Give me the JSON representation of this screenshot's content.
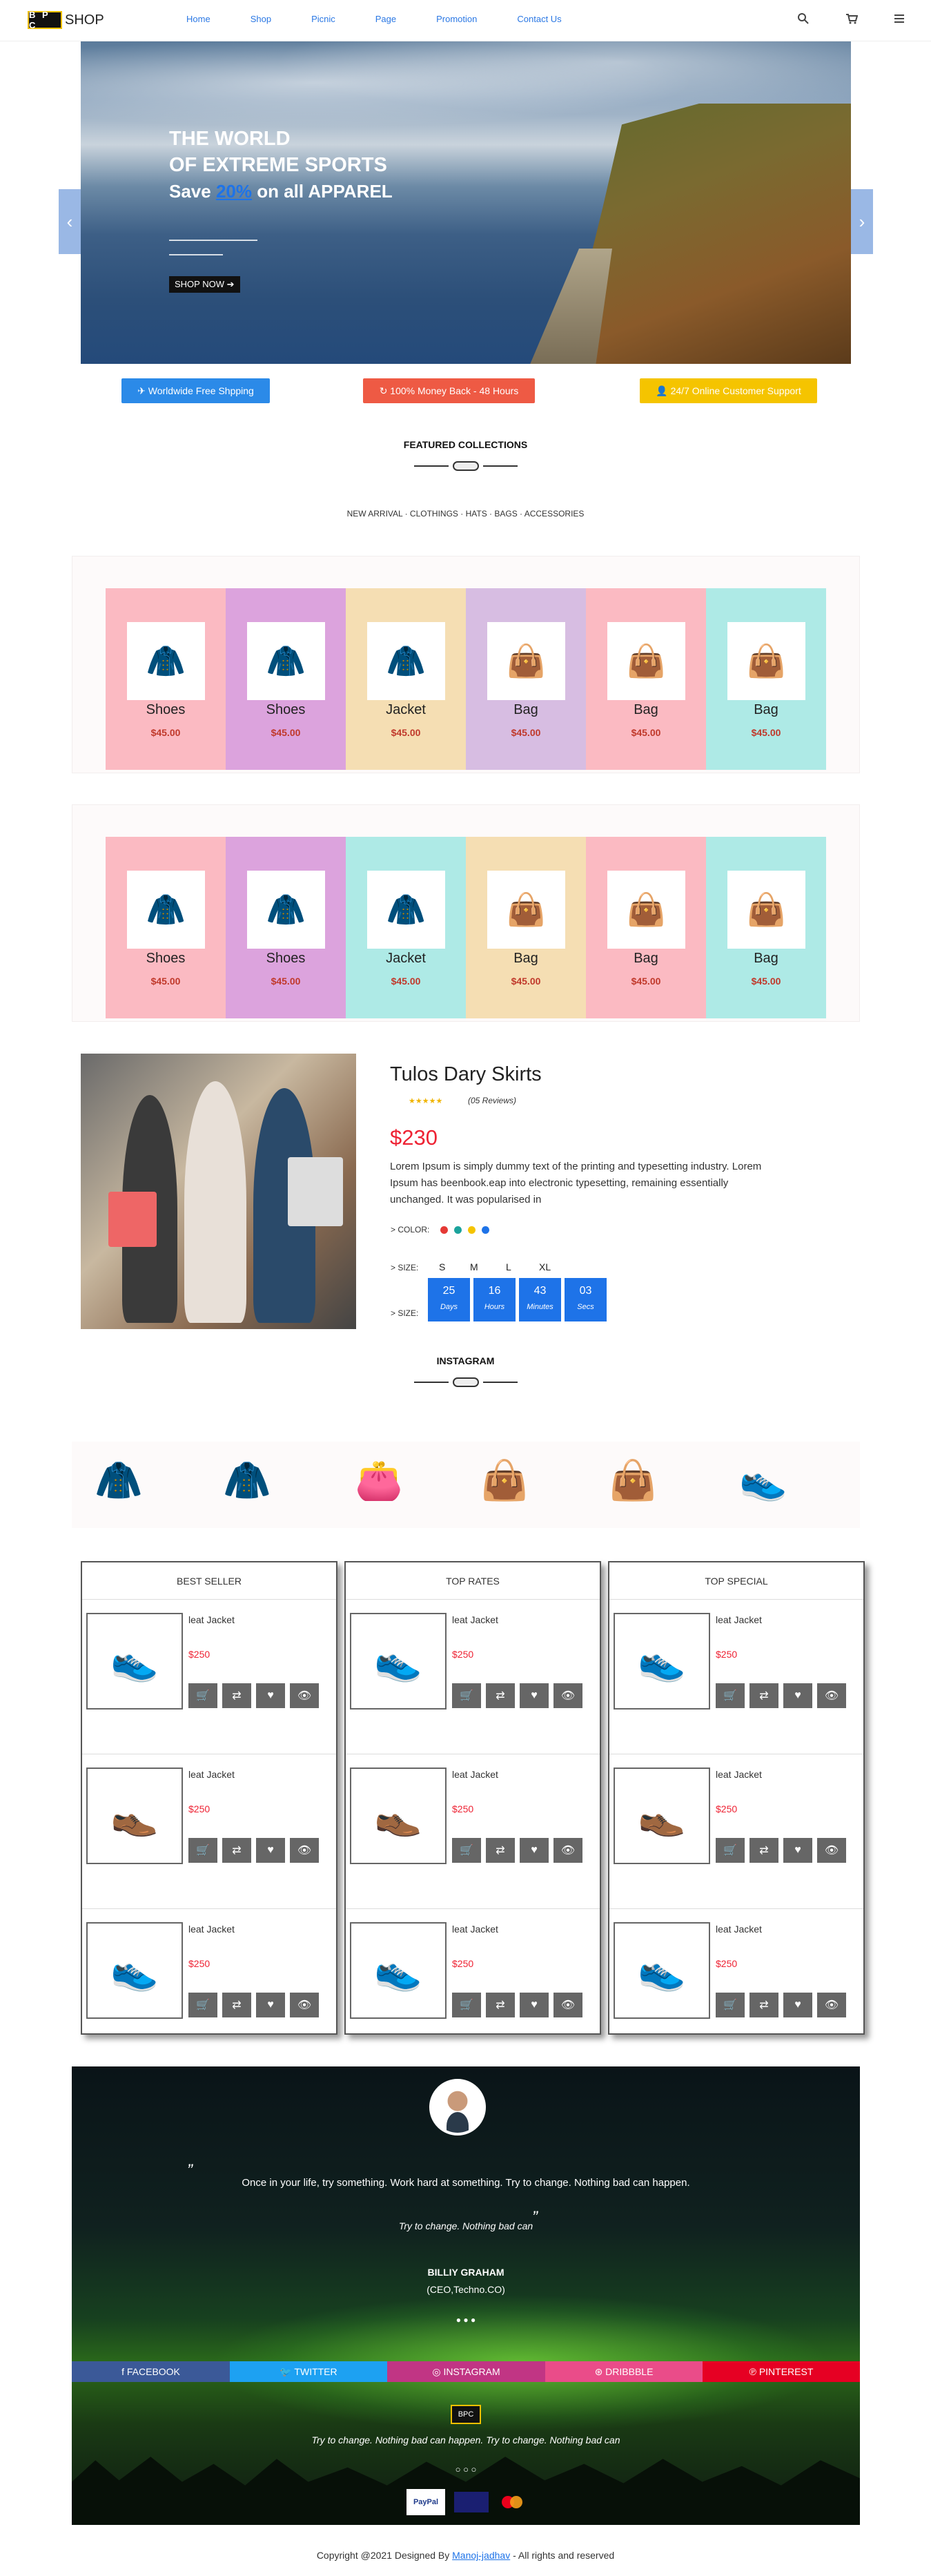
{
  "nav": {
    "logo_mark": "B P C",
    "logo_text": "SHOP",
    "links": [
      "Home",
      "Shop",
      "Picnic",
      "Page",
      "Promotion",
      "Contact Us"
    ]
  },
  "hero": {
    "line1": "THE WORLD",
    "line2": "OF EXTREME SPORTS",
    "save_pre": "Save ",
    "save_pct": "20%",
    "save_post": " on all APPAREL",
    "cta": "SHOP NOW ➔"
  },
  "features": [
    "✈ Worldwide Free Shpping",
    "↻ 100% Money Back - 48 Hours",
    "👤 24/7 Online Customer Support"
  ],
  "featured": {
    "title": "FEATURED COLLECTIONS",
    "filters": "NEW ARRIVAL  ·  CLOTHINGS  ·  HATS  ·  BAGS  ·  ACCESSORIES"
  },
  "row1": [
    {
      "name": "Shoes",
      "price": "$45.00"
    },
    {
      "name": "Shoes",
      "price": "$45.00"
    },
    {
      "name": "Jacket",
      "price": "$45.00"
    },
    {
      "name": "Bag",
      "price": "$45.00"
    },
    {
      "name": "Bag",
      "price": "$45.00"
    },
    {
      "name": "Bag",
      "price": "$45.00"
    }
  ],
  "row2": [
    {
      "name": "Shoes",
      "price": "$45.00"
    },
    {
      "name": "Shoes",
      "price": "$45.00"
    },
    {
      "name": "Jacket",
      "price": "$45.00"
    },
    {
      "name": "Bag",
      "price": "$45.00"
    },
    {
      "name": "Bag",
      "price": "$45.00"
    },
    {
      "name": "Bag",
      "price": "$45.00"
    }
  ],
  "product": {
    "title": "Tulos Dary Skirts",
    "stars": "★★★★★",
    "reviews": "(05 Reviews)",
    "price": "$230",
    "desc": "Lorem Ipsum is simply dummy text of the printing and typesetting industry. Lorem Ipsum has beenbook.eap into electronic typesetting, remaining essentially unchanged. It was popularised in",
    "color_label": "> COLOR:",
    "size_label": "> SIZE:",
    "size_label2": "> SIZE:",
    "sizes": [
      "S",
      "M",
      "L",
      "XL"
    ],
    "countdown": [
      {
        "n": "25",
        "u": "Days"
      },
      {
        "n": "16",
        "u": "Hours"
      },
      {
        "n": "43",
        "u": "Minutes"
      },
      {
        "n": "03",
        "u": "Secs"
      }
    ]
  },
  "instagram": {
    "title": "INSTAGRAM"
  },
  "lists": [
    {
      "title": "BEST SELLER"
    },
    {
      "title": "TOP RATES"
    },
    {
      "title": "TOP SPECIAL"
    }
  ],
  "list_item": {
    "name": "leat Jacket",
    "price": "$250"
  },
  "testimonial": {
    "open_quote": "”",
    "quote": "Once in your life, try something. Work hard at something. Try to change. Nothing bad can happen.",
    "sub": "Try to change. Nothing bad can",
    "close_quote": "”",
    "name": "BILLIY GRAHAM",
    "role": "(CEO,Techno.CO)",
    "tagline": "Try to change. Nothing bad can happen. Try to change. Nothing bad can"
  },
  "social": [
    "f FACEBOOK",
    "🐦 TWITTER",
    "◎ INSTAGRAM",
    "⊛ DRIBBBLE",
    "℗ PINTEREST"
  ],
  "footer": {
    "pay1": "PayPal",
    "copy_pre": "Copyright @2021 Designed By ",
    "author": "Manoj-jadhav",
    "copy_post": " - All rights and reserved"
  },
  "colors": {
    "accent": "#1e73e8",
    "price": "#c0392b",
    "pink": "#fbbac2",
    "violet": "#dca3dd",
    "peach": "#f5deb3",
    "mauve": "#d7bde2",
    "aqua": "#aeeae6"
  }
}
